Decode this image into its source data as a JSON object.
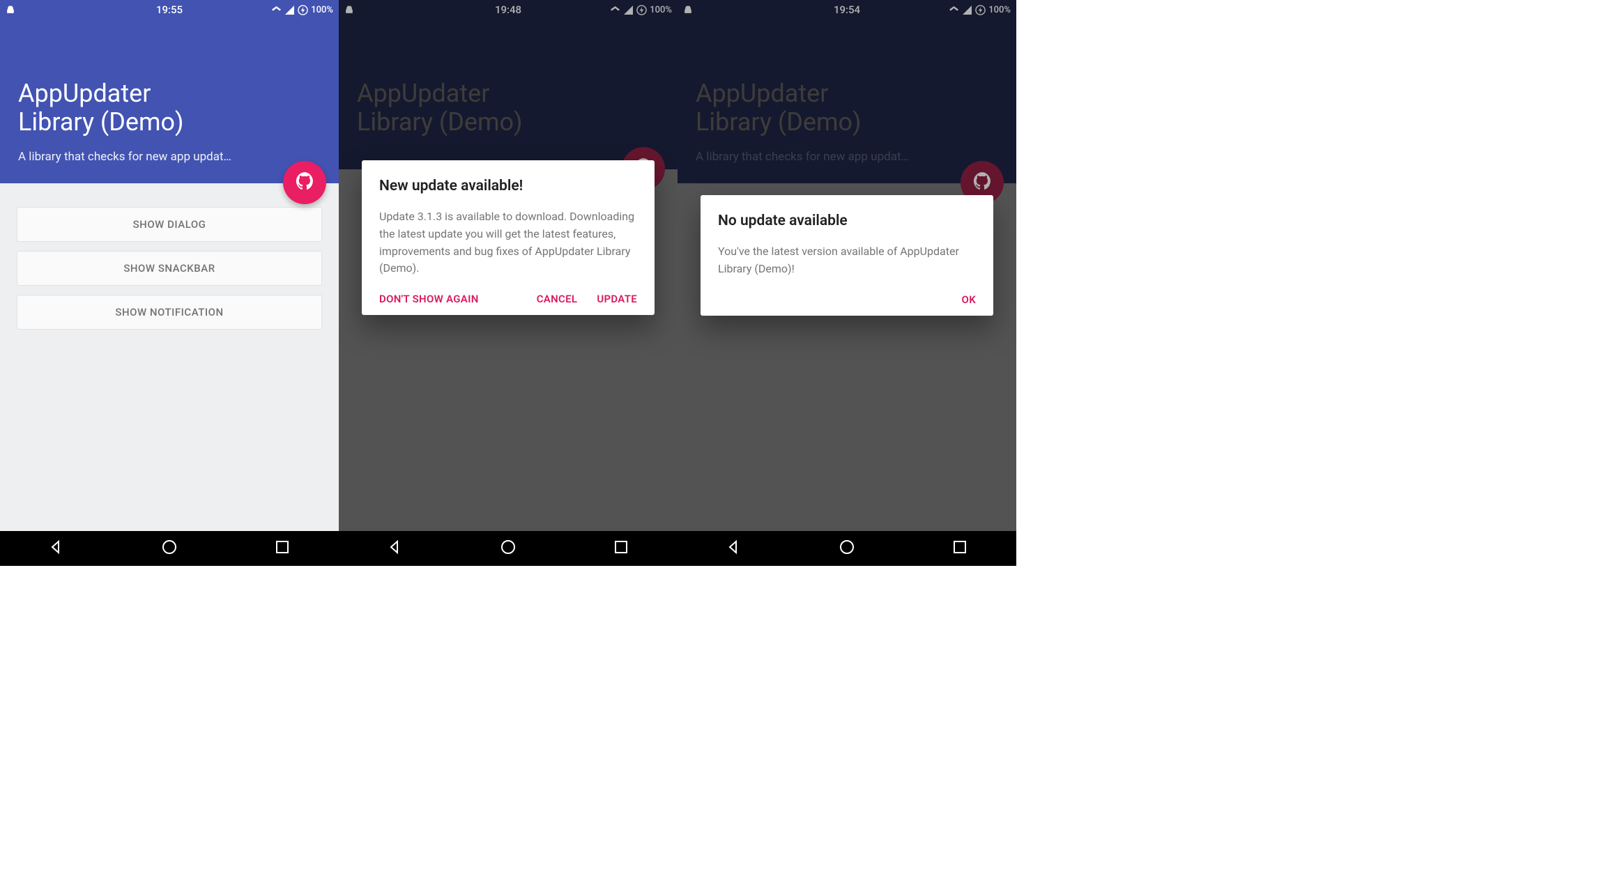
{
  "screens": [
    {
      "statusbar": {
        "time": "19:55",
        "battery": "100%"
      },
      "hero": {
        "title_l1": "AppUpdater",
        "title_l2": "Library (Demo)",
        "subtitle": "A library that checks for new app updat…"
      },
      "buttons": {
        "dialog": "SHOW DIALOG",
        "snackbar": "SHOW SNACKBAR",
        "notification": "SHOW NOTIFICATION"
      }
    },
    {
      "statusbar": {
        "time": "19:48",
        "battery": "100%"
      },
      "hero": {
        "title_l1": "AppUpdater",
        "title_l2": "Library (Demo)",
        "subtitle": ""
      },
      "dialog": {
        "title": "New update available!",
        "body": "Update 3.1.3 is available to download. Downloading the latest update you will get the latest features, improvements and bug fixes of AppUpdater Library (Demo).",
        "neg": "DON'T SHOW AGAIN",
        "cancel": "CANCEL",
        "pos": "UPDATE"
      }
    },
    {
      "statusbar": {
        "time": "19:54",
        "battery": "100%"
      },
      "hero": {
        "title_l1": "AppUpdater",
        "title_l2": "Library (Demo)",
        "subtitle": "A library that checks for new app updat…"
      },
      "dialog": {
        "title": "No update available",
        "body": "You've the latest version available of AppUpdater Library (Demo)!",
        "ok": "OK"
      }
    }
  ]
}
